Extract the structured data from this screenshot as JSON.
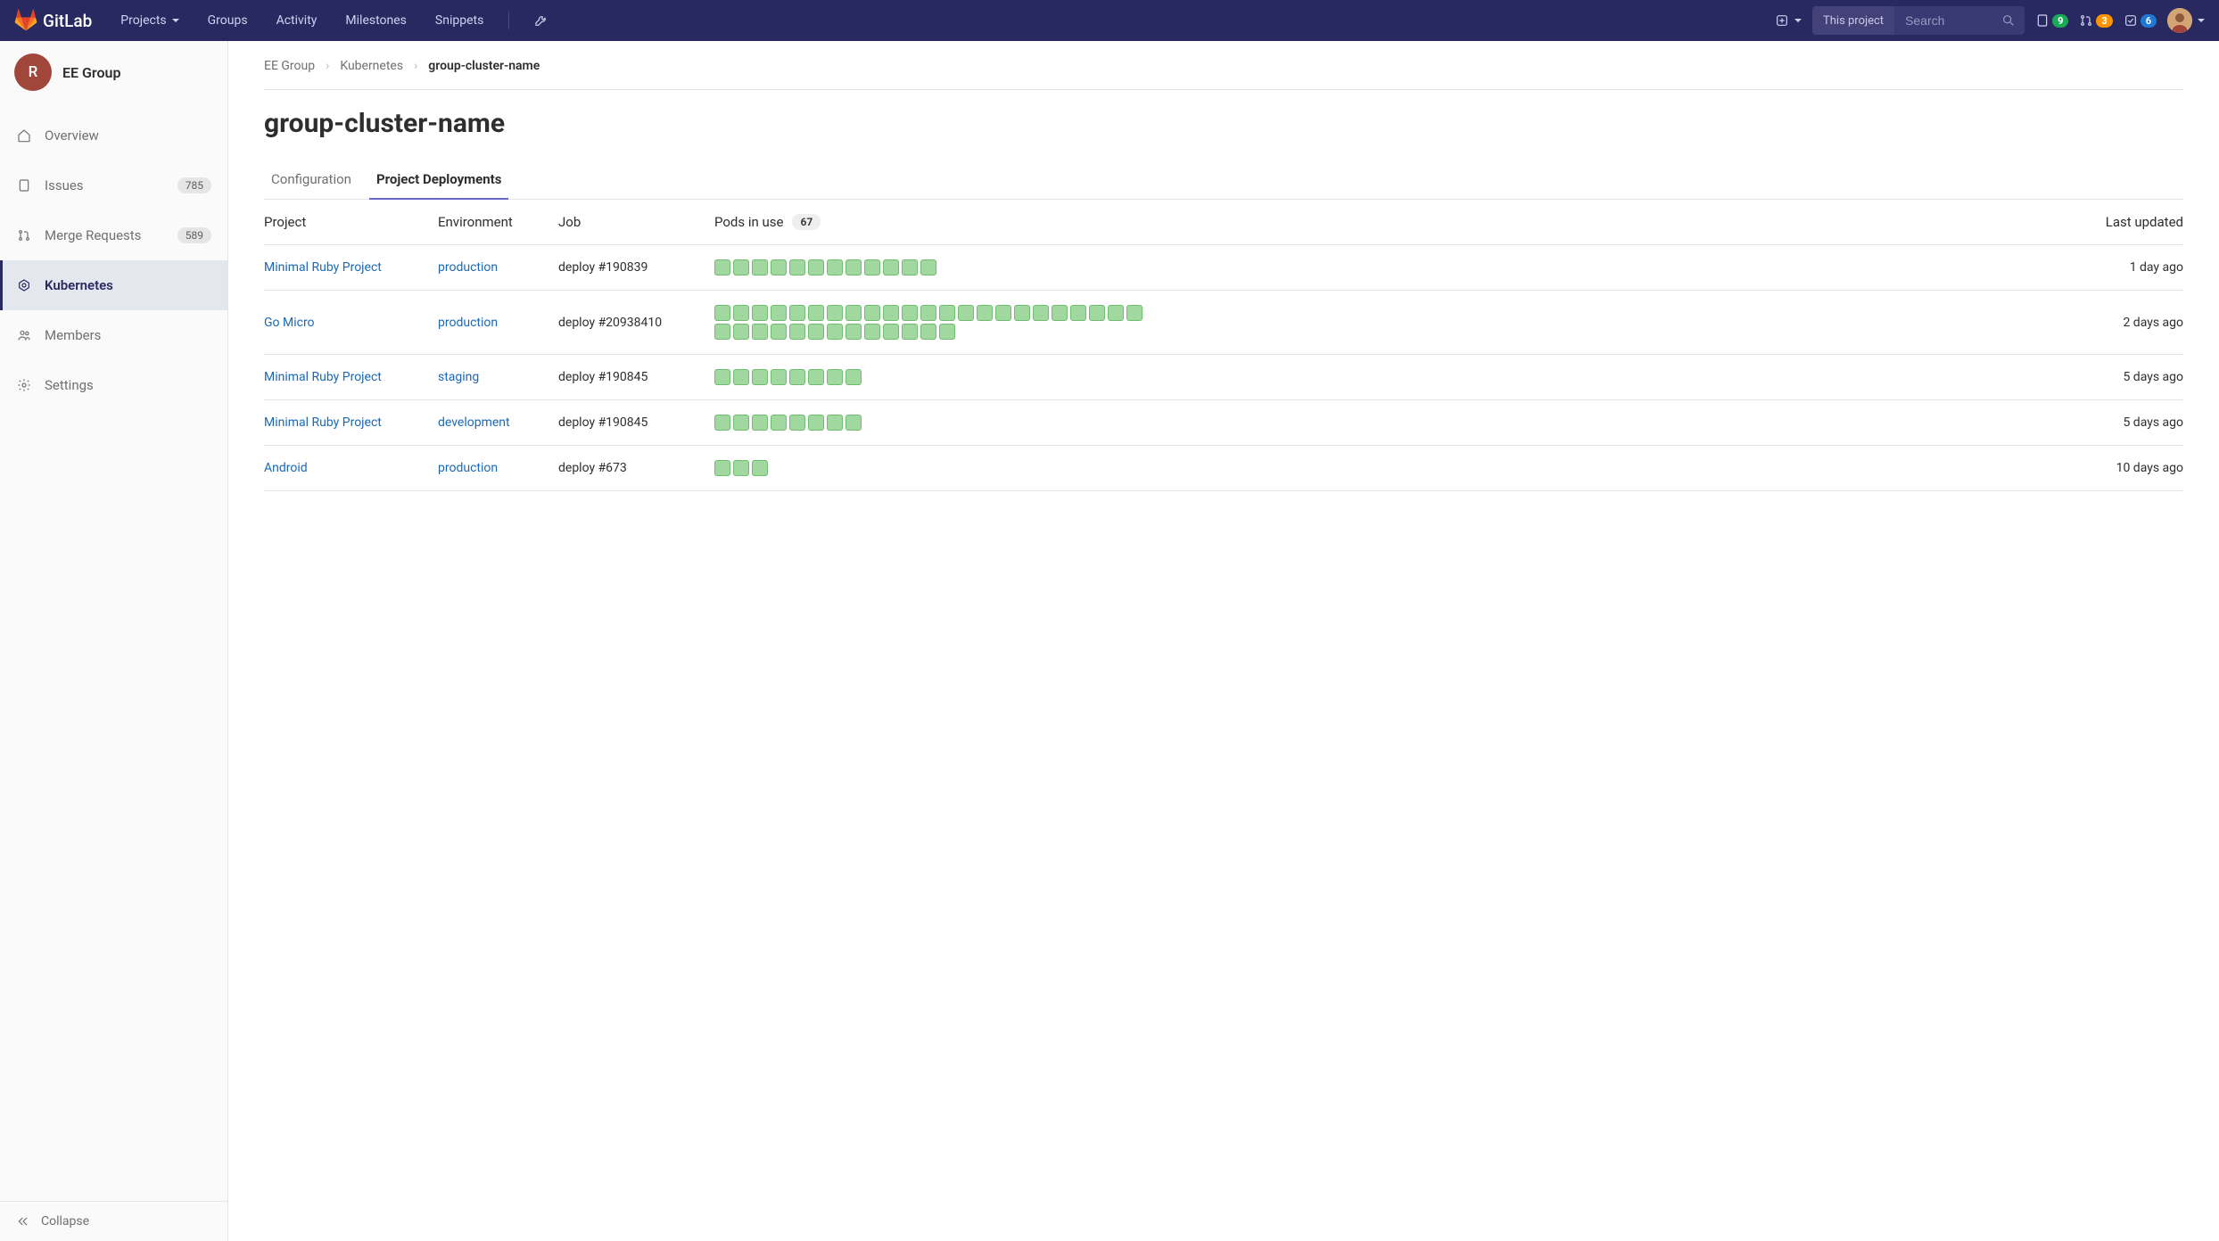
{
  "brand": "GitLab",
  "nav": {
    "projects": "Projects",
    "groups": "Groups",
    "activity": "Activity",
    "milestones": "Milestones",
    "snippets": "Snippets"
  },
  "search": {
    "scope": "This project",
    "placeholder": "Search"
  },
  "header_badges": {
    "issues": "9",
    "mrs": "3",
    "todos": "6"
  },
  "group": {
    "initial": "R",
    "name": "EE Group"
  },
  "sidebar": {
    "overview": "Overview",
    "issues": "Issues",
    "issues_count": "785",
    "mrs": "Merge Requests",
    "mrs_count": "589",
    "kubernetes": "Kubernetes",
    "members": "Members",
    "settings": "Settings",
    "collapse": "Collapse"
  },
  "breadcrumb": {
    "group": "EE Group",
    "section": "Kubernetes",
    "current": "group-cluster-name"
  },
  "page_title": "group-cluster-name",
  "tabs": {
    "configuration": "Configuration",
    "deployments": "Project Deployments"
  },
  "columns": {
    "project": "Project",
    "environment": "Environment",
    "job": "Job",
    "pods": "Pods in use",
    "pods_total": "67",
    "updated": "Last updated"
  },
  "rows": [
    {
      "project": "Minimal Ruby Project",
      "env": "production",
      "job": "deploy #190839",
      "pods": 12,
      "updated": "1 day ago"
    },
    {
      "project": "Go Micro",
      "env": "production",
      "job": "deploy #20938410",
      "pods": 36,
      "updated": "2 days ago"
    },
    {
      "project": "Minimal Ruby Project",
      "env": "staging",
      "job": "deploy #190845",
      "pods": 8,
      "updated": "5 days ago"
    },
    {
      "project": "Minimal Ruby Project",
      "env": "development",
      "job": "deploy #190845",
      "pods": 8,
      "updated": "5 days ago"
    },
    {
      "project": "Android",
      "env": "production",
      "job": "deploy #673",
      "pods": 3,
      "updated": "10 days ago"
    }
  ]
}
